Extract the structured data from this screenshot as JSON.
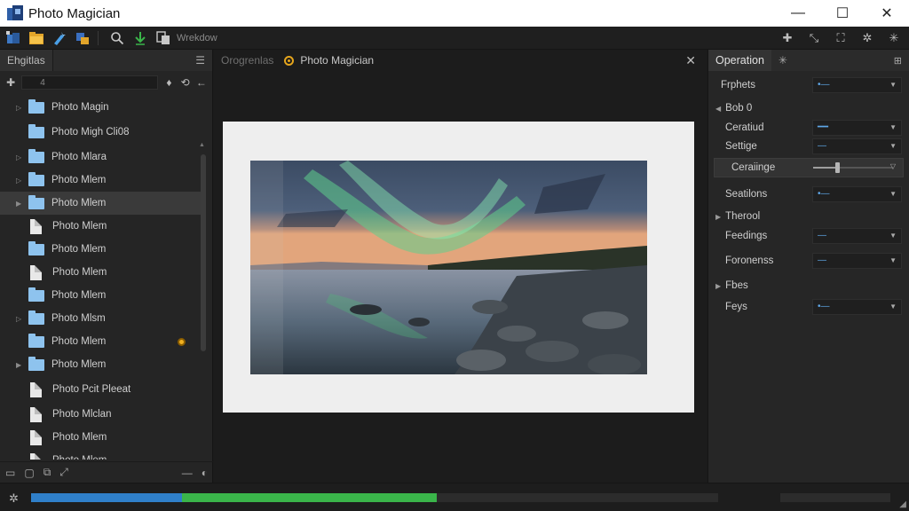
{
  "window": {
    "title": "Photo Magician",
    "controls": {
      "minimize": "—",
      "maximize": "☐",
      "close": "✕"
    }
  },
  "toolbar": {
    "label": "Wrekdow",
    "icons": [
      "app-icon",
      "open-folder-icon",
      "wand-icon",
      "layers-icon",
      "search-icon",
      "download-icon",
      "copy-icon"
    ],
    "right_icons": [
      "plus-icon",
      "wand-icon",
      "crop-icon",
      "gear-icon",
      "sparkle-icon"
    ]
  },
  "left_panel": {
    "tab": "Ehgitlas",
    "search_value": "4",
    "items": [
      {
        "label": "Photo Magin",
        "type": "folder",
        "arrow": "▷"
      },
      {
        "label": "Photo Migh Cli08",
        "type": "folder",
        "arrow": ""
      },
      {
        "label": "Photo Mlara",
        "type": "folder",
        "arrow": "▷"
      },
      {
        "label": "Photo Mlem",
        "type": "folder",
        "arrow": "▷"
      },
      {
        "label": "Photo Mlem",
        "type": "folder",
        "arrow": "▶",
        "selected": true
      },
      {
        "label": "Photo Mlem",
        "type": "file",
        "arrow": ""
      },
      {
        "label": "Photo Mlem",
        "type": "folder",
        "arrow": ""
      },
      {
        "label": "Photo Mlem",
        "type": "file",
        "arrow": ""
      },
      {
        "label": "Photo Mlem",
        "type": "folder",
        "arrow": ""
      },
      {
        "label": "Photo Mlsm",
        "type": "folder",
        "arrow": "▷"
      },
      {
        "label": "Photo Mlem",
        "type": "folder",
        "arrow": "",
        "badge": true
      },
      {
        "label": "Photo Mlem",
        "type": "folder",
        "arrow": "▶"
      },
      {
        "label": "Photo Pcit Pleeat",
        "type": "file",
        "arrow": ""
      },
      {
        "label": "Photo Mlclan",
        "type": "file",
        "arrow": ""
      },
      {
        "label": "Photo Mlem",
        "type": "file",
        "arrow": ""
      },
      {
        "label": "Photo Mlem",
        "type": "file",
        "arrow": ""
      }
    ]
  },
  "center": {
    "inactive_tab": "Orogrenlas",
    "active_tab": "Photo Magician",
    "close": "✕"
  },
  "right_panel": {
    "tab": "Operation",
    "props": [
      {
        "label": "Frphets",
        "value": "•—",
        "kind": "dropdown",
        "section": true
      },
      {
        "label": "Bob 0",
        "kind": "section",
        "arrow": "◀"
      },
      {
        "label": "Ceratiud",
        "value": "━━",
        "kind": "dropdown"
      },
      {
        "label": "Settige",
        "value": "—",
        "kind": "dropdown"
      },
      {
        "label": "Ceraiinge",
        "kind": "slider",
        "level": 0.3
      },
      {
        "label": "Seatilons",
        "value": "•—",
        "kind": "dropdown"
      },
      {
        "label": "Therool",
        "kind": "section",
        "arrow": "▶"
      },
      {
        "label": "Feedings",
        "value": "—",
        "kind": "dropdown"
      },
      {
        "label": "Foronenss",
        "value": "—",
        "kind": "dropdown"
      },
      {
        "label": "Fbes",
        "kind": "section",
        "arrow": "▶"
      },
      {
        "label": "Feys",
        "value": "•—",
        "kind": "dropdown"
      }
    ]
  },
  "status": {
    "progress_blue": 0.22,
    "progress_green": 0.59
  },
  "colors": {
    "accent_blue": "#2f7fc9",
    "accent_green": "#3ab54a",
    "badge_orange": "#f0b020",
    "folder_blue": "#8ec3ee"
  }
}
